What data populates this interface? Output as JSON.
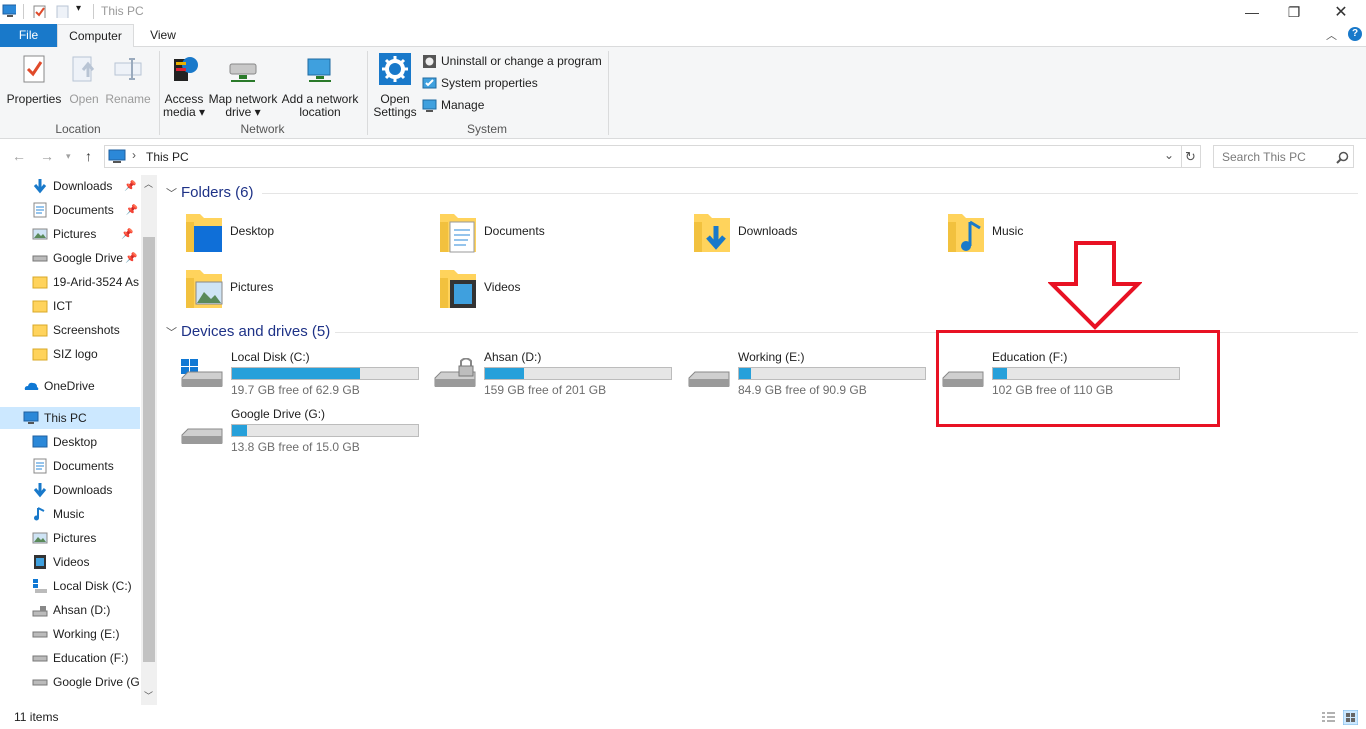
{
  "window": {
    "title": "This PC"
  },
  "tabs": {
    "file": "File",
    "computer": "Computer",
    "view": "View"
  },
  "ribbon": {
    "location": {
      "label": "Location",
      "properties": "Properties",
      "open": "Open",
      "rename": "Rename"
    },
    "network": {
      "label": "Network",
      "access_media": [
        "Access",
        "media"
      ],
      "map_drive": [
        "Map network",
        "drive"
      ],
      "add_location": [
        "Add a network",
        "location"
      ]
    },
    "system": {
      "label": "System",
      "open_settings": [
        "Open",
        "Settings"
      ],
      "uninstall": "Uninstall or change a program",
      "sys_props": "System properties",
      "manage": "Manage"
    }
  },
  "address": {
    "path": "This PC",
    "search_placeholder": "Search This PC"
  },
  "sidebar": {
    "quick": [
      "Downloads",
      "Documents",
      "Pictures",
      "Google Drive",
      "19-Arid-3524 As",
      "ICT",
      "Screenshots",
      "SIZ logo"
    ],
    "onedrive": "OneDrive",
    "thispc": "This PC",
    "pc_items": [
      "Desktop",
      "Documents",
      "Downloads",
      "Music",
      "Pictures",
      "Videos",
      "Local Disk (C:)",
      "Ahsan (D:)",
      "Working (E:)",
      "Education (F:)",
      "Google Drive (G:"
    ]
  },
  "folders": {
    "heading": "Folders (6)",
    "items": [
      "Desktop",
      "Documents",
      "Downloads",
      "Music",
      "Pictures",
      "Videos"
    ]
  },
  "drives": {
    "heading": "Devices and drives (5)",
    "items": [
      {
        "name": "Local Disk (C:)",
        "free": "19.7 GB free of 62.9 GB",
        "used_fraction": 0.687
      },
      {
        "name": "Ahsan (D:)",
        "free": "159 GB free of 201 GB",
        "used_fraction": 0.209
      },
      {
        "name": "Working (E:)",
        "free": "84.9 GB free of 90.9 GB",
        "used_fraction": 0.066
      },
      {
        "name": "Education (F:)",
        "free": "102 GB free of 110 GB",
        "used_fraction": 0.073
      },
      {
        "name": "Google Drive (G:)",
        "free": "13.8 GB free of 15.0 GB",
        "used_fraction": 0.08
      }
    ]
  },
  "status": {
    "items": "11 items"
  },
  "colors": {
    "accent": "#1979ca",
    "bar_fill": "#26a0da",
    "highlight": "#e81123",
    "selection": "#cce8ff"
  }
}
